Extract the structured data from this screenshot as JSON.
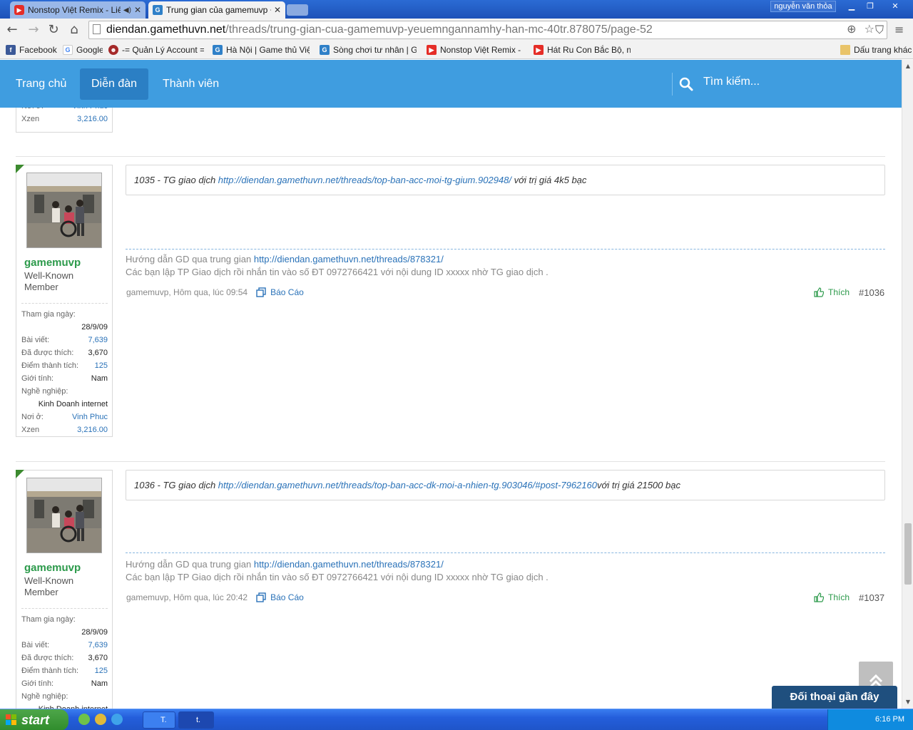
{
  "browser": {
    "tabs": [
      {
        "title": "Nonstop Việt Remix - Liên",
        "icon": "youtube-icon",
        "active": false
      },
      {
        "title": "Trung gian của gamemuvp +",
        "icon": "gamevn-icon",
        "active": true
      }
    ],
    "user": "nguyễn văn thỏa",
    "url_host": "diendan.gamethuvn.net",
    "url_path": "/threads/trung-gian-cua-gamemuvp-yeuemngannamhy-han-mc-40tr.878075/page-52",
    "bookmarks": [
      {
        "label": "Facebook",
        "icon": "facebook-icon"
      },
      {
        "label": "Google",
        "icon": "google-icon"
      },
      {
        "label": "-= Quản Lý Account =-",
        "icon": "account-icon"
      },
      {
        "label": "Hà Nội | Game thủ Việt N",
        "icon": "gamevn-icon"
      },
      {
        "label": "Sòng chơi tư nhân | Gam",
        "icon": "gamevn-icon"
      },
      {
        "label": "Nonstop Việt Remix - Liê",
        "icon": "youtube-icon"
      },
      {
        "label": "Hát Ru Con Bắc Bộ, nhữ",
        "icon": "youtube-icon"
      }
    ],
    "other_bookmarks": "Dấu trang khác"
  },
  "site_nav": {
    "items": [
      "Trang chủ",
      "Diễn đàn",
      "Thành viên"
    ],
    "active": "Diễn đàn",
    "search_placeholder": "Tìm kiếm..."
  },
  "top_card_partial": {
    "noi_o_label": "Nơi ở:",
    "noi_o": "Vinh Phuc",
    "xzen_label": "Xzen",
    "xzen": "3,216.00"
  },
  "posts": [
    {
      "content_prefix": "1035 - TG giao dịch ",
      "content_link": "http://diendan.gamethuvn.net/threads/top-ban-acc-moi-tg-gium.902948/",
      "content_suffix": " với trị giá 4k5 bạc",
      "sig_line1_text": "Hướng dẫn GD qua trung gian ",
      "sig_line1_link": "http://diendan.gamethuvn.net/threads/878321/",
      "sig_line2": "Các bạn lập TP Giao dịch rồi nhắn tin vào số ĐT 0972766421 với nội dung ID xxxxx nhờ TG giao dịch .",
      "meta": "gamemuvp, Hôm qua, lúc 09:54",
      "report": "Báo Cáo",
      "like": "Thích",
      "number": "#1036"
    },
    {
      "content_prefix": "1036 - TG giao dịch ",
      "content_link": "http://diendan.gamethuvn.net/threads/top-ban-acc-dk-moi-a-nhien-tg.903046/#post-7962160",
      "content_suffix": "với trị giá 21500 bạc",
      "sig_line1_text": "Hướng dẫn GD qua trung gian ",
      "sig_line1_link": "http://diendan.gamethuvn.net/threads/878321/",
      "sig_line2": "Các bạn lập TP Giao dịch rồi nhắn tin vào số ĐT 0972766421 với nội dung ID xxxxx nhờ TG giao dịch .",
      "meta": "gamemuvp, Hôm qua, lúc 20:42",
      "report": "Báo Cáo",
      "like": "Thích",
      "number": "#1037"
    }
  ],
  "user": {
    "name": "gamemuvp",
    "title": "Well-Known Member",
    "joined_label": "Tham gia ngày:",
    "joined": "28/9/09",
    "posts_label": "Bài viết:",
    "posts": "7,639",
    "liked_label": "Đã được thích:",
    "liked": "3,670",
    "points_label": "Điểm thành tích:",
    "points": "125",
    "gender_label": "Giới tính:",
    "gender": "Nam",
    "job_label": "Nghề nghiệp:",
    "job": "Kinh Doanh internet",
    "location_label": "Nơi ở:",
    "location": "Vinh Phuc",
    "xzen_label": "Xzen",
    "xzen": "3,216.00"
  },
  "recent_chat": "Đối thoại gần đây",
  "taskbar": {
    "start": "start",
    "tasks": [
      "T.",
      "t."
    ],
    "clock": "6:16 PM"
  }
}
